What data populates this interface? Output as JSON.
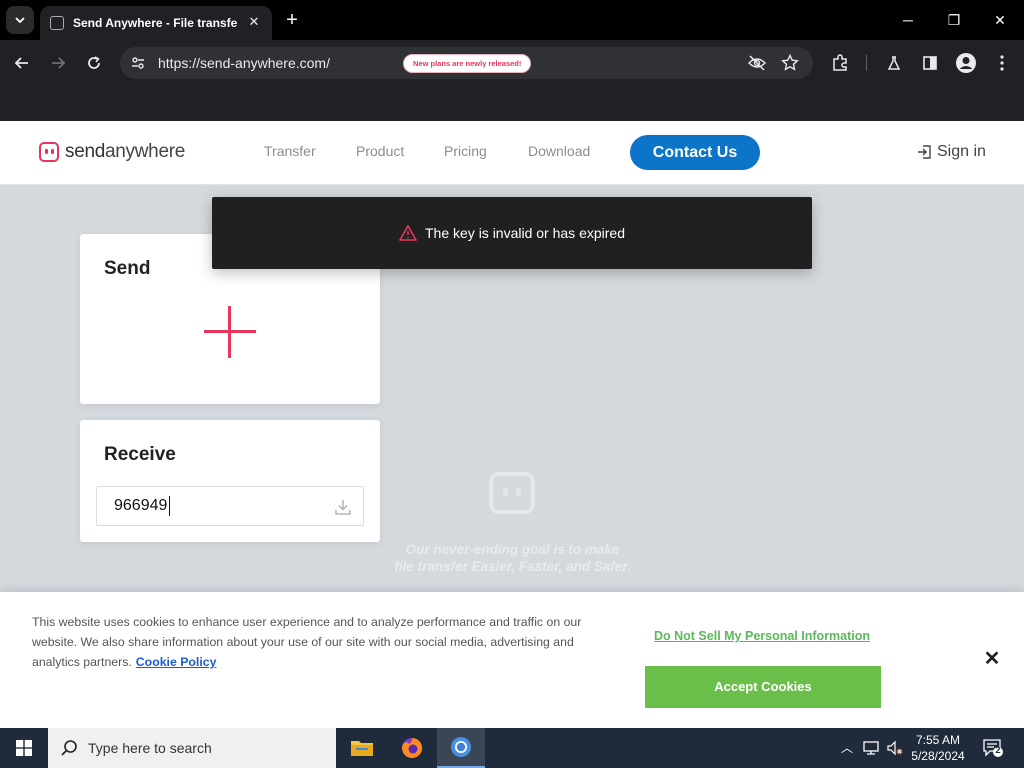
{
  "browser": {
    "tab_title": "Send Anywhere - File transfer",
    "tab_close": "✕",
    "new_tab": "+",
    "url": "https://send-anywhere.com/",
    "window_controls": {
      "minimize": "─",
      "restore": "❐",
      "close": "✕"
    }
  },
  "site": {
    "logo": {
      "part1": "send",
      "part2": "anywhere"
    },
    "nav": [
      "Transfer",
      "Product",
      "Pricing",
      "Download"
    ],
    "promo_badge": "New plans are newly released!",
    "contact_label": "Contact Us",
    "signin_label": "Sign in"
  },
  "toast": {
    "message": "The key is invalid or has expired"
  },
  "send_card": {
    "title": "Send"
  },
  "receive_card": {
    "title": "Receive",
    "key_value": "966949"
  },
  "tagline": {
    "line1": "Our never-ending goal is to make",
    "line2": "file transfer Easier, Faster, and Safer."
  },
  "cookie_banner": {
    "text": "This website uses cookies to enhance user experience and to analyze performance and traffic on our website. We also share information about your use of our site with our social media, advertising and analytics partners.",
    "policy_link": "Cookie Policy",
    "dns_link": "Do Not Sell My Personal Information",
    "accept_label": "Accept Cookies",
    "close": "✕"
  },
  "taskbar": {
    "search_placeholder": "Type here to search",
    "time": "7:55 AM",
    "date": "5/28/2024",
    "notification_count": "2"
  },
  "colors": {
    "brand_pink": "#e8355a",
    "contact_blue": "#0c74c9",
    "accept_green": "#6abf4b",
    "toast_bg": "#202020"
  }
}
